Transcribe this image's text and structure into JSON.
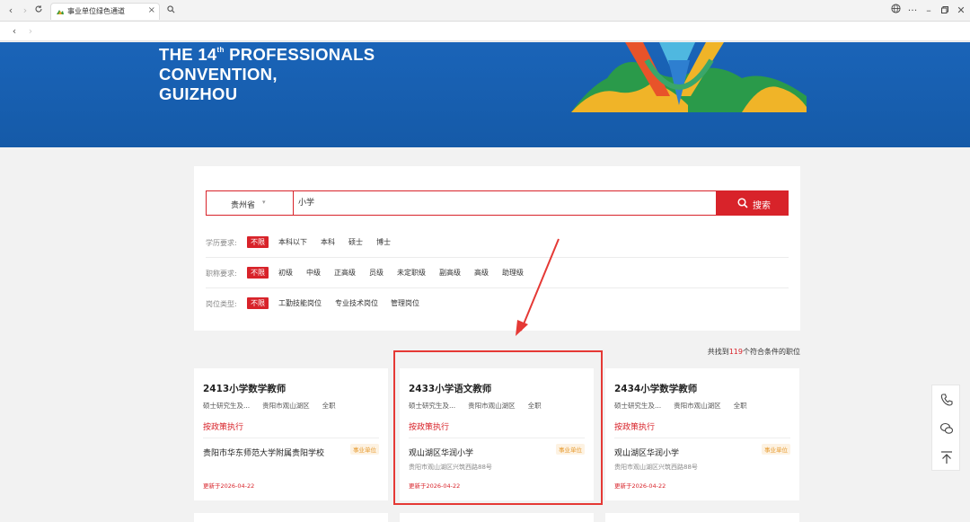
{
  "browser": {
    "tab_title": "事业单位绿色通道",
    "tab_close": "×"
  },
  "banner": {
    "line1_a": "THE 14",
    "line1_sup": "th",
    "line1_b": "PROFESSIONALS",
    "line2": "CONVENTION,",
    "line3": "GUIZHOU"
  },
  "search": {
    "province": "贵州省",
    "keyword": "小学",
    "button_label": "搜索"
  },
  "filters": [
    {
      "label": "学历要求:",
      "options": [
        "不限",
        "本科以下",
        "本科",
        "硕士",
        "博士"
      ]
    },
    {
      "label": "职称要求:",
      "options": [
        "不限",
        "初级",
        "中级",
        "正高级",
        "员级",
        "未定职级",
        "副高级",
        "高级",
        "助理级"
      ]
    },
    {
      "label": "岗位类型:",
      "options": [
        "不限",
        "工勤技能岗位",
        "专业技术岗位",
        "管理岗位"
      ]
    }
  ],
  "results": {
    "prefix": "共找到",
    "count": "119",
    "suffix": "个符合条件的职位"
  },
  "cards": [
    {
      "title": "2413小学数学教师",
      "education": "硕士研究生及...",
      "location": "贵阳市观山湖区",
      "type": "全职",
      "salary": "按政策执行",
      "org": "贵阳市华东师范大学附属贵阳学校",
      "badge": "事业单位",
      "address": "",
      "updated": "更新于2026-04-22"
    },
    {
      "title": "2433小学语文教师",
      "education": "硕士研究生及...",
      "location": "贵阳市观山湖区",
      "type": "全职",
      "salary": "按政策执行",
      "org": "观山湖区华润小学",
      "badge": "事业单位",
      "address": "贵阳市观山湖区兴筑西路88号",
      "updated": "更新于2026-04-22"
    },
    {
      "title": "2434小学数学教师",
      "education": "硕士研究生及...",
      "location": "贵阳市观山湖区",
      "type": "全职",
      "salary": "按政策执行",
      "org": "观山湖区华润小学",
      "badge": "事业单位",
      "address": "贵阳市观山湖区兴筑西路88号",
      "updated": "更新于2026-04-22"
    }
  ],
  "colors": {
    "accent": "#d8232a",
    "banner": "#1a64b8",
    "badge": "#e69a2e",
    "annotation": "#e53935"
  },
  "icons": [
    "back-icon",
    "forward-icon",
    "refresh-icon",
    "search-icon",
    "globe-icon",
    "more-icon",
    "minimize-icon",
    "restore-icon",
    "close-icon",
    "phone-icon",
    "wechat-icon",
    "back-to-top-icon"
  ]
}
